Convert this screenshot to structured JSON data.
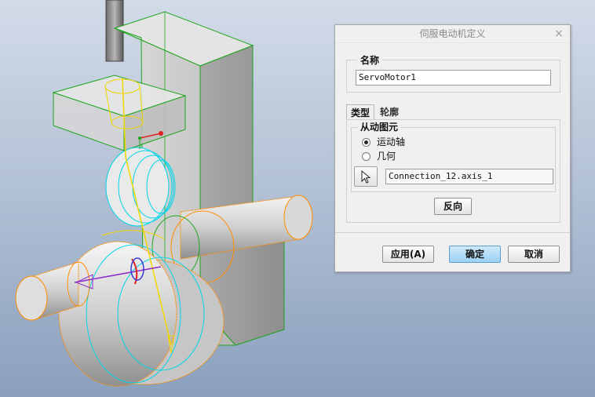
{
  "dialog": {
    "title": "伺服电动机定义",
    "close_glyph": "×",
    "name_group_label": "名称",
    "name_value": "ServoMotor1",
    "tabs": [
      {
        "label": "类型",
        "active": true
      },
      {
        "label": "轮廓",
        "active": false
      }
    ],
    "driven_group_label": "从动图元",
    "options": [
      {
        "label": "运动轴",
        "selected": true
      },
      {
        "label": "几何",
        "selected": false
      }
    ],
    "selector_icon": "cursor-arrow-icon",
    "reference_value": "Connection_12.axis_1",
    "flip_button": "反向",
    "apply_button": "应用(A)",
    "ok_button": "确定",
    "cancel_button": "取消"
  },
  "viewport": {
    "background_top": "#d2dbe8",
    "background_bottom": "#8aa0bd",
    "colors": {
      "edge_green": "#1ea51e",
      "edge_orange": "#ff8c00",
      "edge_cyan": "#00d5e8",
      "axis_yellow": "#f2d600",
      "motor_purple": "#8d2cc8",
      "axis_red": "#e02020"
    }
  }
}
